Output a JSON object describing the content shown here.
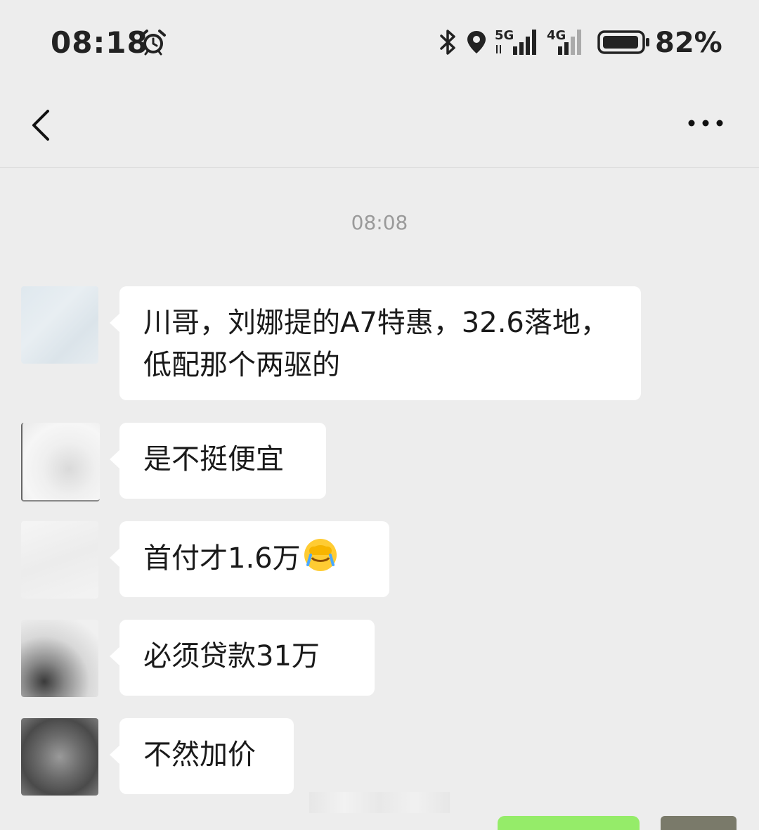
{
  "status_bar": {
    "time": "08:18",
    "battery_percent": "82%",
    "network_1": "5G",
    "network_2": "4G",
    "battery_level": 0.82
  },
  "nav": {
    "title": "",
    "back_icon": "chevron-left-icon",
    "more_icon": "more-dots-icon"
  },
  "chat": {
    "timestamp": "08:08",
    "messages": [
      {
        "sender": "other",
        "text": "川哥，刘娜提的A7特惠，32.6落地，低配那个两驱的"
      },
      {
        "sender": "other",
        "text": "是不挺便宜"
      },
      {
        "sender": "other",
        "text": "首付才1.6万",
        "emoji": "face-palm-crying-emoji"
      },
      {
        "sender": "other",
        "text": "必须贷款31万"
      },
      {
        "sender": "other",
        "text": "不然加价"
      }
    ]
  },
  "colors": {
    "background": "#ededed",
    "bubble_incoming": "#ffffff",
    "bubble_outgoing": "#95ec69",
    "timestamp_text": "#9a9a9a"
  }
}
